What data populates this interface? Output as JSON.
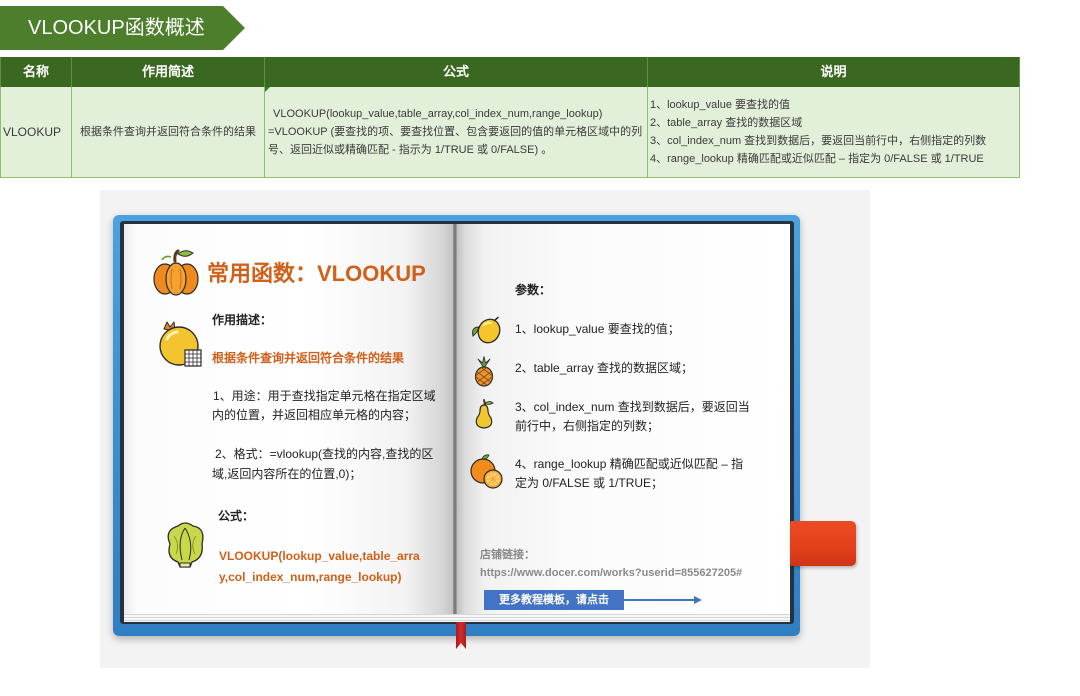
{
  "banner": {
    "title": "VLOOKUP函数概述"
  },
  "table": {
    "headers": {
      "name": "名称",
      "summary": "作用简述",
      "formula": "公式",
      "notes": "说明"
    },
    "row": {
      "name": "VLOOKUP",
      "summary": "根据条件查询并返回符合条件的结果",
      "formula_lines": [
        "VLOOKUP(lookup_value,table_array,col_index_num,range_lookup)",
        "=VLOOKUP (要查找的项、要查找位置、包含要返回的值的单元格区域中的列",
        "号、返回近似或精确匹配 - 指示为 1/TRUE 或 0/FALSE) 。"
      ],
      "notes": [
        "1、lookup_value 要查找的值",
        "2、table_array 查找的数据区域",
        "3、col_index_num 查找到数据后，要返回当前行中，右侧指定的列数",
        "4、range_lookup 精确匹配或近似匹配 – 指定为 0/FALSE 或 1/TRUE"
      ]
    }
  },
  "book": {
    "left_page": {
      "title_icon": "pumpkin-icon",
      "title": "常用函数：VLOOKUP",
      "desc_icon": "pomegranate-icon",
      "desc_heading": "作用描述：",
      "desc_highlight": "根据条件查询并返回符合条件的结果",
      "usage_lines": [
        "1、用途：用于查找指定单元格在指定区域",
        "内的位置，并返回相应单元格的内容；"
      ],
      "format_lines": [
        "2、格式：=vlookup(查找的内容,查找的区",
        "域,返回内容所在的位置,0)；"
      ],
      "formula_icon": "cabbage-icon",
      "formula_heading": "公式：",
      "formula_lines": [
        "VLOOKUP(lookup_value,table_arra",
        "y,col_index_num,range_lookup)"
      ]
    },
    "right_page": {
      "params_heading": "参数：",
      "params": [
        {
          "icon": "lemon-icon",
          "lines": [
            "1、lookup_value 要查找的值；"
          ]
        },
        {
          "icon": "pineapple-icon",
          "lines": [
            "2、table_array 查找的数据区域；"
          ]
        },
        {
          "icon": "pear-icon",
          "lines": [
            "3、col_index_num 查找到数据后，要返回当",
            "前行中，右侧指定的列数；"
          ]
        },
        {
          "icon": "orange-icon",
          "lines": [
            "4、range_lookup 精确匹配或近似匹配 – 指",
            "定为 0/FALSE 或 1/TRUE；"
          ]
        }
      ],
      "shop_label": "店铺链接：",
      "shop_url": "https://www.docer.com/works?userid=855627205#",
      "cta_label": "更多教程模板，请点击",
      "cta_icon": "arrow-right-icon"
    }
  },
  "colors": {
    "banner": "#4c7e2b",
    "header": "#3b6821",
    "row": "#e2efd9",
    "accent_orange": "#d0601a",
    "cover_blue": "#3b8fd1",
    "bookmark_red": "#e2401b",
    "cta_blue": "#4472c4"
  }
}
